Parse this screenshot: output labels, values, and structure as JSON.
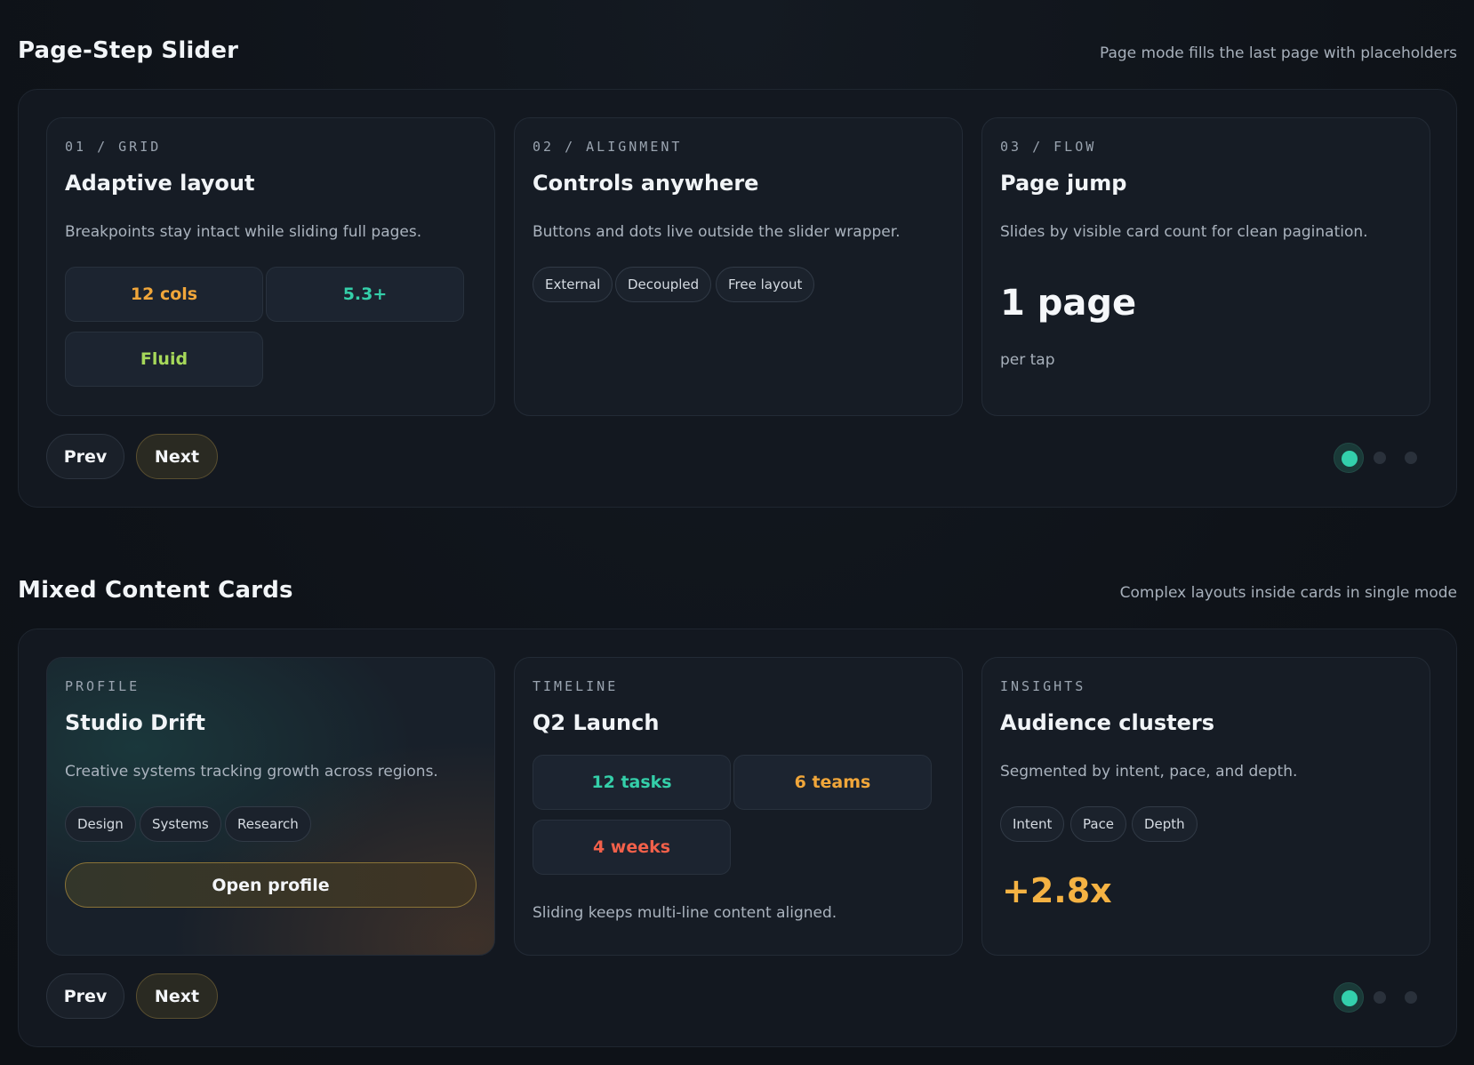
{
  "sections": [
    {
      "title": "Page-Step Slider",
      "subtitle": "Page mode fills the last page with placeholders",
      "cards": [
        {
          "eyebrow": "01 / GRID",
          "title": "Adaptive layout",
          "desc": "Breakpoints stay intact while sliding full pages.",
          "stats": [
            "12 cols",
            "5.3+",
            "Fluid"
          ]
        },
        {
          "eyebrow": "02 / ALIGNMENT",
          "title": "Controls anywhere",
          "desc": "Buttons and dots live outside the slider wrapper.",
          "chips": [
            "External",
            "Decoupled",
            "Free layout"
          ]
        },
        {
          "eyebrow": "03 / FLOW",
          "title": "Page jump",
          "desc": "Slides by visible card count for clean pagination.",
          "big": "1 page",
          "big_sub": "per tap"
        }
      ],
      "prev_label": "Prev",
      "next_label": "Next",
      "active_dot": 1,
      "dot_count": 3
    },
    {
      "title": "Mixed Content Cards",
      "subtitle": "Complex layouts inside cards in single mode",
      "cards": [
        {
          "eyebrow": "PROFILE",
          "title": "Studio Drift",
          "desc": "Creative systems tracking growth across regions.",
          "chips": [
            "Design",
            "Systems",
            "Research"
          ],
          "button": "Open profile"
        },
        {
          "eyebrow": "TIMELINE",
          "title": "Q2 Launch",
          "stats": [
            "12 tasks",
            "6 teams",
            "4 weeks"
          ],
          "note": "Sliding keeps multi-line content aligned."
        },
        {
          "eyebrow": "INSIGHTS",
          "title": "Audience clusters",
          "desc": "Segmented by intent, pace, and depth.",
          "chips": [
            "Intent",
            "Pace",
            "Depth"
          ],
          "big": "+2.8x"
        }
      ],
      "prev_label": "Prev",
      "next_label": "Next",
      "active_dot": 1,
      "dot_count": 3
    }
  ],
  "colors": {
    "accent_teal": "#33d0ac",
    "accent_orange": "#f0a63a",
    "accent_lime": "#a6d85a",
    "accent_red": "#f2604a",
    "background": "#0f1319"
  }
}
